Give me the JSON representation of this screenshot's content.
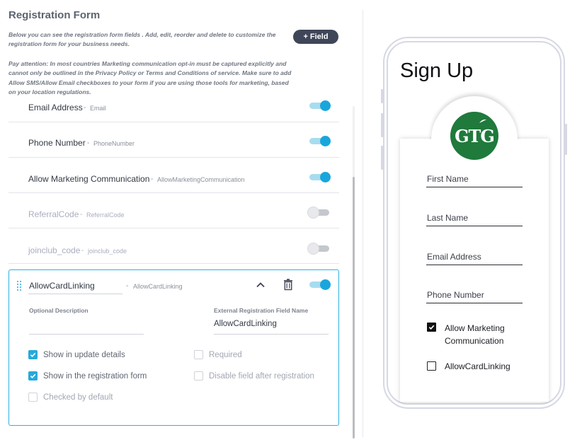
{
  "header": {
    "title": "Registration Form",
    "add_field_label": "Field",
    "description": "Below you can see the registration form fields . Add, edit, reorder and delete to customize the registration form for your business needs.",
    "attention": "Pay attention: In most countries Marketing communication opt-in must be captured explicitly and cannot only be outlined in the Privacy Policy or Terms and Conditions of service. Make sure to add Allow SMS/Allow Email checkboxes to your form if you are using those tools for marketing, based on your location regulations."
  },
  "fields": [
    {
      "label": "Email Address",
      "key": "Email",
      "enabled": true
    },
    {
      "label": "Phone Number",
      "key": "PhoneNumber",
      "enabled": true
    },
    {
      "label": "Allow Marketing Communication",
      "key": "AllowMarketingCommunication",
      "enabled": true
    },
    {
      "label": "ReferralCode",
      "key": "ReferralCode",
      "enabled": false
    },
    {
      "label": "joinclub_code",
      "key": "joinclub_code",
      "enabled": false
    }
  ],
  "separator": "-",
  "expanded": {
    "label": "AllowCardLinking",
    "key": "AllowCardLinking",
    "enabled": true,
    "optional_description_label": "Optional Description",
    "optional_description_value": "",
    "external_name_label": "External Registration Field Name",
    "external_name_value": "AllowCardLinking",
    "options": {
      "show_update_details": {
        "label": "Show in update details",
        "checked": true
      },
      "required": {
        "label": "Required",
        "checked": false
      },
      "show_registration": {
        "label": "Show in the registration form",
        "checked": true
      },
      "disable_after": {
        "label": "Disable field after registration",
        "checked": false
      },
      "checked_default": {
        "label": "Checked by default",
        "checked": false
      }
    }
  },
  "preview": {
    "title": "Sign Up",
    "logo_text": "GTG",
    "logo_color": "#1f7a3b",
    "inputs": [
      "First Name",
      "Last Name",
      "Email Address",
      "Phone Number"
    ],
    "checkboxes": [
      {
        "label": "Allow Marketing Communication",
        "checked": true
      },
      {
        "label": "AllowCardLinking",
        "checked": false
      }
    ]
  },
  "colors": {
    "accent": "#1aa6dc",
    "button_dark": "#3f4658"
  }
}
